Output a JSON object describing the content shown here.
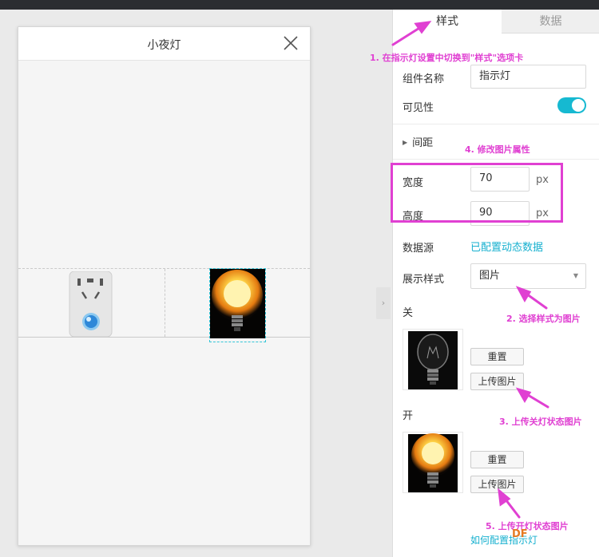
{
  "preview": {
    "title": "小夜灯",
    "close_icon": "close-icon"
  },
  "panel": {
    "tabs": [
      {
        "label": "样式",
        "active": true
      },
      {
        "label": "数据",
        "active": false
      }
    ],
    "component_name": {
      "label": "组件名称",
      "value": "指示灯"
    },
    "visibility": {
      "label": "可见性",
      "on": true
    },
    "spacing_section": "间距",
    "width": {
      "label": "宽度",
      "value": "70",
      "unit": "px"
    },
    "height": {
      "label": "高度",
      "value": "90",
      "unit": "px"
    },
    "datasource": {
      "label": "数据源",
      "link": "已配置动态数据"
    },
    "display_style": {
      "label": "展示样式",
      "value": "图片"
    },
    "off": {
      "label": "关",
      "reset": "重置",
      "upload": "上传图片"
    },
    "on": {
      "label": "开",
      "reset": "重置",
      "upload": "上传图片"
    },
    "help_link": "如何配置指示灯"
  },
  "annotations": {
    "a1": "1. 在指示灯设置中切换到\"样式\"选项卡",
    "a2": "2. 选择样式为图片",
    "a3": "3. 上传关灯状态图片",
    "a4": "4. 修改图片属性",
    "a5": "5. 上传开灯状态图片"
  },
  "watermark": "DF",
  "colors": {
    "accent": "#16b9d1",
    "annotation": "#e040d2"
  }
}
